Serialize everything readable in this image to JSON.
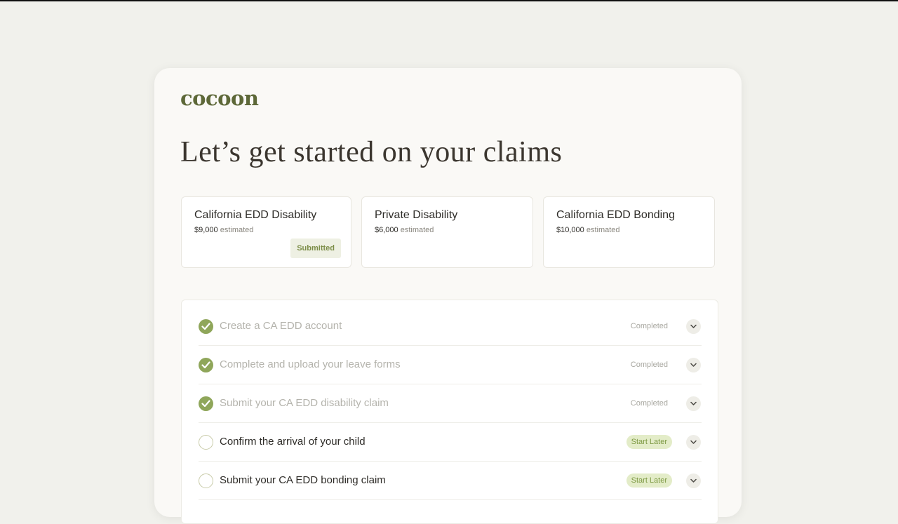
{
  "app": {
    "logo": "cocoon"
  },
  "page": {
    "title": "Let’s get started on your claims"
  },
  "claims": [
    {
      "name": "California EDD Disability",
      "amount": "$9,000",
      "suffix": "estimated",
      "badge": "Submitted"
    },
    {
      "name": "Private Disability",
      "amount": "$6,000",
      "suffix": "estimated"
    },
    {
      "name": "California EDD Bonding",
      "amount": "$10,000",
      "suffix": "estimated"
    }
  ],
  "tasks": [
    {
      "label": "Create a CA EDD account",
      "status": "Completed",
      "state": "completed"
    },
    {
      "label": "Complete and upload your leave forms",
      "status": "Completed",
      "state": "completed"
    },
    {
      "label": "Submit your CA EDD disability claim",
      "status": "Completed",
      "state": "completed"
    },
    {
      "label": "Confirm the arrival of your child",
      "status": "Start Later",
      "state": "pending"
    },
    {
      "label": "Submit your CA EDD bonding claim",
      "status": "Start Later",
      "state": "pending"
    }
  ],
  "icons": {
    "completed": "check-circle-icon",
    "pending": "empty-circle-icon",
    "expand": "chevron-down-icon"
  },
  "colors": {
    "brand": "#5d6838",
    "completed": "#8fa65a",
    "start_later_bg": "#e3ecc8",
    "submitted_bg": "#eef0e3"
  }
}
